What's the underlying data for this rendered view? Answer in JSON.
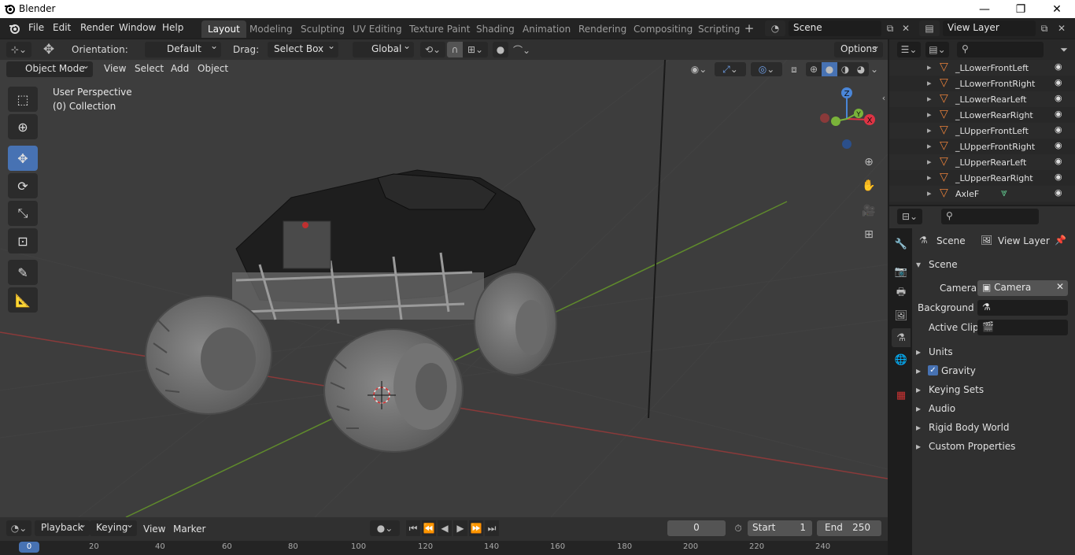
{
  "app": {
    "title": "Blender"
  },
  "menu": [
    "File",
    "Edit",
    "Render",
    "Window",
    "Help"
  ],
  "workspaces": [
    "Layout",
    "Modeling",
    "Sculpting",
    "UV Editing",
    "Texture Paint",
    "Shading",
    "Animation",
    "Rendering",
    "Compositing",
    "Scripting"
  ],
  "scene_field": "Scene",
  "view_layer_field": "View Layer",
  "toolbar": {
    "orientation_label": "Orientation:",
    "orientation_value": "Default",
    "drag_label": "Drag:",
    "drag_value": "Select Box",
    "transform_value": "Global",
    "options_label": "Options"
  },
  "viewport": {
    "mode": "Object Mode",
    "menus": [
      "View",
      "Select",
      "Add",
      "Object"
    ],
    "overlay_line1": "User Perspective",
    "overlay_line2": "(0) Collection",
    "gizmo": {
      "z": "Z",
      "y": "Y",
      "x": "X"
    }
  },
  "outliner": {
    "items": [
      "_LLowerFrontLeft",
      "_LLowerFrontRight",
      "_LLowerRearLeft",
      "_LLowerRearRight",
      "_LUpperFrontLeft",
      "_LUpperFrontRight",
      "_LUpperRearLeft",
      "_LUpperRearRight",
      "AxleF"
    ]
  },
  "properties": {
    "tab_scene": "Scene",
    "tab_view_layer": "View Layer",
    "panel_title": "Scene",
    "camera_label": "Camera",
    "camera_value": "Camera",
    "background_label": "Background ...",
    "active_clip_label": "Active Clip",
    "sections": [
      "Units",
      "Gravity",
      "Keying Sets",
      "Audio",
      "Rigid Body World",
      "Custom Properties"
    ]
  },
  "timeline": {
    "menus": [
      "Playback",
      "Keying",
      "View",
      "Marker"
    ],
    "current_frame": "0",
    "start_label": "Start",
    "start_value": "1",
    "end_label": "End",
    "end_value": "250",
    "ruler": [
      "0",
      "20",
      "40",
      "60",
      "80",
      "100",
      "120",
      "140",
      "160",
      "180",
      "200",
      "220",
      "240"
    ]
  },
  "colors": {
    "accent": "#4772b3",
    "viewport_bg": "#3d3d3d",
    "panel_bg": "#303030",
    "object_orange": "#e8803a"
  }
}
